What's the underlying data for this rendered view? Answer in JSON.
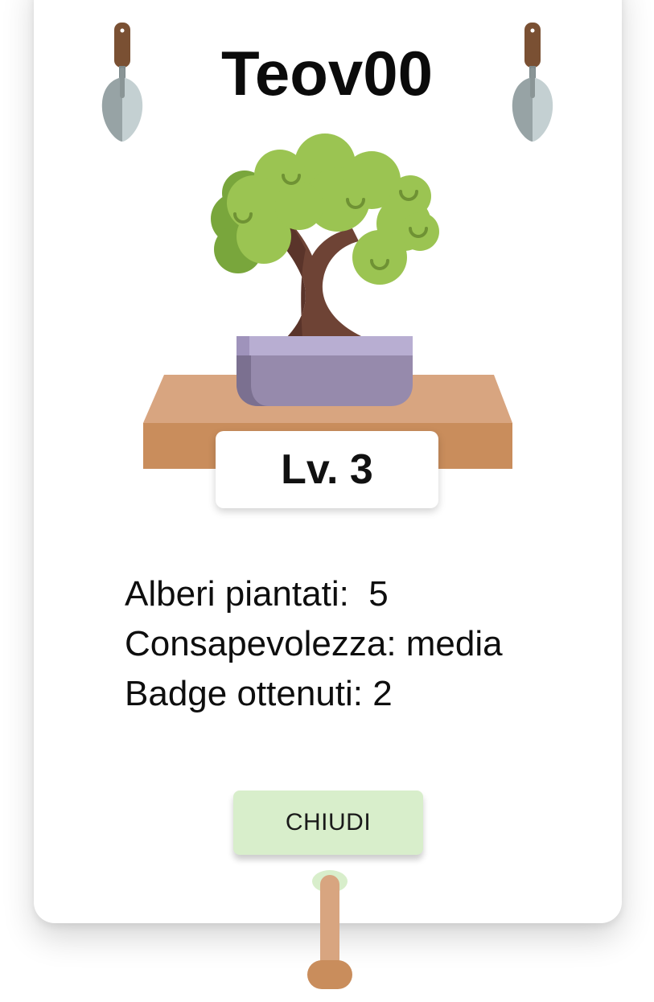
{
  "profile": {
    "username": "Teov00",
    "level_label": "Lv. 3"
  },
  "stats": [
    {
      "label": "Alberi piantati:",
      "value": "5",
      "gap": "  "
    },
    {
      "label": "Consapevolezza:",
      "value": "media",
      "gap": " "
    },
    {
      "label": "Badge ottenuti:",
      "value": "2",
      "gap": " "
    }
  ],
  "actions": {
    "close_label": "CHIUDI"
  },
  "icons": {
    "left_trowel": "trowel-icon",
    "right_trowel": "trowel-icon",
    "illustration": "bonsai-tree-icon",
    "pull_handle": "handle-icon"
  },
  "colors": {
    "button_bg": "#d8eecb",
    "foliage": "#9bc452",
    "trunk": "#6e4335",
    "pot": "#968aac",
    "shelf": "#d8a580"
  }
}
